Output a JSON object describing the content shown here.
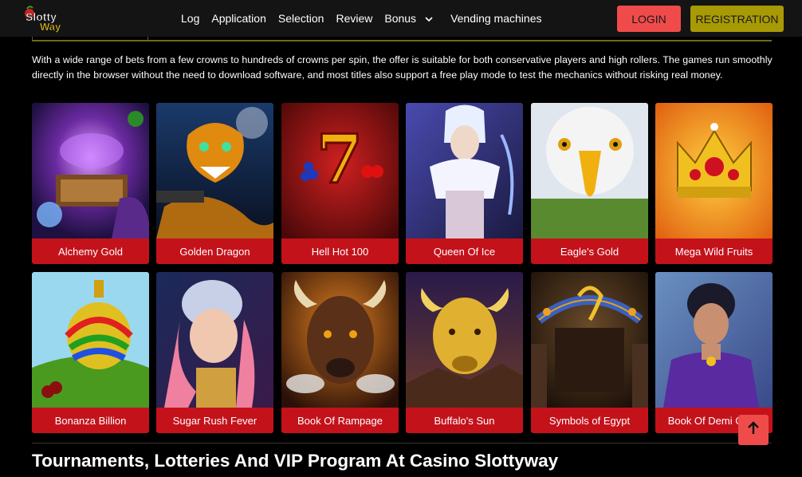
{
  "header": {
    "logo_text": "Slotty Way",
    "nav": [
      {
        "label": "Log"
      },
      {
        "label": "Application"
      },
      {
        "label": "Selection"
      },
      {
        "label": "Review"
      },
      {
        "label": "Bonus"
      },
      {
        "label": "Vending machines"
      }
    ],
    "login_label": "LOGIN",
    "registration_label": "REGISTRATION",
    "colors": {
      "login": "#f04b4b",
      "registration": "#a89a05",
      "background": "#141414"
    }
  },
  "intro": {
    "text": "With a wide range of bets from a few crowns to hundreds of crowns per spin, the offer is suitable for both conservative players and high rollers. The games run smoothly directly in the browser without the need to download software, and most titles also support a free play mode to test the mechanics without risking real money."
  },
  "games": [
    {
      "title": "Alchemy Gold"
    },
    {
      "title": "Golden Dragon"
    },
    {
      "title": "Hell Hot 100"
    },
    {
      "title": "Queen Of Ice"
    },
    {
      "title": "Eagle's Gold"
    },
    {
      "title": "Mega Wild Fruits"
    },
    {
      "title": "Bonanza Billion"
    },
    {
      "title": "Sugar Rush Fever"
    },
    {
      "title": "Book Of Rampage"
    },
    {
      "title": "Buffalo's Sun"
    },
    {
      "title": "Symbols of Egypt"
    },
    {
      "title": "Book Of Demi Gods"
    }
  ],
  "section": {
    "heading": "Tournaments, Lotteries And VIP Program At Casino Slottyway"
  },
  "icons": {
    "bonus_dropdown": "chevron-down-icon",
    "scroll_top": "arrow-up-icon"
  },
  "label_color": "#c4121b"
}
